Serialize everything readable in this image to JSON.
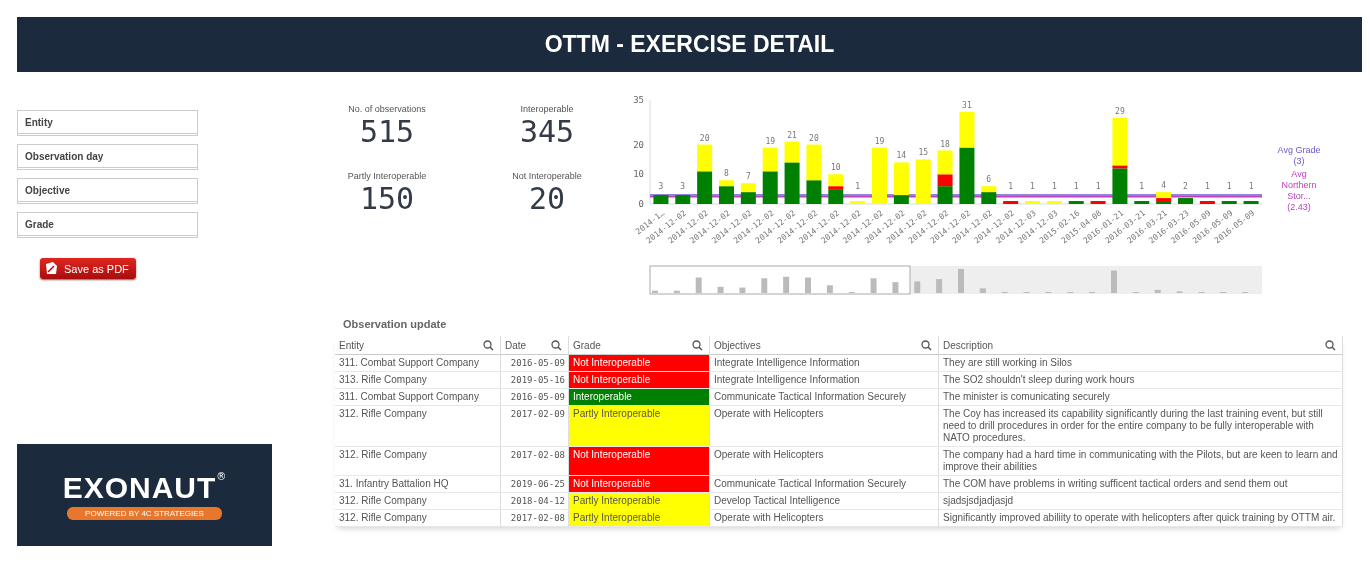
{
  "header": {
    "title": "OTTM - EXERCISE DETAIL"
  },
  "filters": [
    {
      "label": "Entity"
    },
    {
      "label": "Observation day"
    },
    {
      "label": "Objective"
    },
    {
      "label": "Grade"
    }
  ],
  "save_button": {
    "label": "Save as PDF"
  },
  "logo": {
    "name": "EXONAUT",
    "mark": "®",
    "tagline": "POWERED BY 4C STRATEGIES"
  },
  "kpis": [
    {
      "label": "No. of observations",
      "value": "515"
    },
    {
      "label": "Interoperable",
      "value": "345"
    },
    {
      "label": "Partly Interoperable",
      "value": "150"
    },
    {
      "label": "Not Interoperable",
      "value": "20"
    }
  ],
  "chart": {
    "chart_data": {
      "type": "bar",
      "stacked": true,
      "ylim": [
        0,
        35
      ],
      "yticks": [
        0,
        10,
        20,
        35
      ],
      "categories": [
        "2014-1…",
        "2014-12-02",
        "2014-12-02",
        "2014-12-02",
        "2014-12-02",
        "2014-12-02",
        "2014-12-02",
        "2014-12-02",
        "2014-12-02",
        "2014-12-02",
        "2014-12-02",
        "2014-12-02",
        "2014-12-02",
        "2014-12-02",
        "2014-12-02",
        "2014-12-02",
        "2014-12-02",
        "2014-12-03",
        "2014-12-03",
        "2015-02-16",
        "2015-04-08",
        "2016-01-21",
        "2016-03-21",
        "2016-03-21",
        "2016-03-23",
        "2016-05-09",
        "2016-05-09",
        "2016-05-09"
      ],
      "series": [
        {
          "color": "#008000",
          "values": [
            3,
            3,
            11,
            6,
            4,
            11,
            14,
            8,
            5,
            0,
            0,
            3,
            0,
            6,
            19,
            4,
            0,
            0,
            0,
            1,
            0,
            12,
            1,
            1,
            2,
            0,
            1,
            1
          ]
        },
        {
          "color": "#ff0000",
          "values": [
            0,
            0,
            0,
            0,
            0,
            0,
            0,
            0,
            1,
            0,
            0,
            0,
            0,
            4,
            0,
            0,
            1,
            0,
            0,
            0,
            1,
            1,
            0,
            1,
            0,
            1,
            0,
            0
          ]
        },
        {
          "color": "#ffff00",
          "values": [
            0,
            0,
            9,
            2,
            3,
            8,
            7,
            12,
            4,
            1,
            19,
            11,
            15,
            8,
            12,
            2,
            0,
            1,
            1,
            0,
            0,
            16,
            0,
            2,
            0,
            0,
            0,
            0
          ]
        }
      ],
      "value_labels": [
        [
          "3",
          "3",
          null,
          null,
          null,
          null,
          null,
          null,
          null,
          null,
          null,
          null,
          null,
          null,
          null,
          null,
          null,
          null,
          null,
          "1",
          null,
          null,
          "1",
          null,
          "2",
          null,
          "1",
          "1"
        ],
        [
          null,
          null,
          null,
          null,
          null,
          null,
          null,
          null,
          null,
          null,
          null,
          null,
          null,
          null,
          null,
          null,
          "1",
          null,
          null,
          null,
          "1",
          null,
          null,
          null,
          null,
          "1",
          null,
          null
        ],
        [
          null,
          null,
          "20",
          "8",
          "7",
          "19",
          "21",
          "20",
          "10",
          "1",
          "19",
          "14",
          "15",
          "18",
          "31",
          "6",
          null,
          "1",
          "1",
          null,
          null,
          "29",
          null,
          "4",
          null,
          null,
          null,
          null
        ]
      ],
      "ref_lines": [
        {
          "axis": "y",
          "value": 3,
          "label": "Avg Grade (3)",
          "color": "#6a5acd"
        },
        {
          "axis": "y",
          "value": 2.43,
          "label": "Avg Northern Stor... (2.43)",
          "color": "#c040c0"
        }
      ]
    }
  },
  "table": {
    "title": "Observation update",
    "columns": [
      {
        "label": "Entity"
      },
      {
        "label": "Date"
      },
      {
        "label": "Grade"
      },
      {
        "label": "Objectives"
      },
      {
        "label": "Description"
      }
    ],
    "rows": [
      {
        "entity": "311. Combat Support Company",
        "date": "2016-05-09",
        "grade": "Not Interoperable",
        "color": "#ff0000",
        "objective": "Integrate Intelligence Information",
        "description": "They are still working in Silos"
      },
      {
        "entity": "313. Rifle Company",
        "date": "2019-05-16",
        "grade": "Not Interoperable",
        "color": "#ff0000",
        "objective": "Integrate Intelligence Information",
        "description": "The SO2 shouldn't sleep during work hours"
      },
      {
        "entity": "311. Combat Support Company",
        "date": "2016-05-09",
        "grade": "Interoperable",
        "color": "#008000",
        "objective": "Communicate Tactical Information Securely",
        "description": "The minister is comunicating securely"
      },
      {
        "entity": "312. Rifle Company",
        "date": "2017-02-09",
        "grade": "Partly Interoperable",
        "color": "#ffff00",
        "objective": "Operate with Helicopters",
        "description": "The Coy has increased its capability significantly during the last training event, but still need to drill procedures in order for the entire company to be fully interoperable with NATO procedures."
      },
      {
        "entity": "312. Rifle Company",
        "date": "2017-02-08",
        "grade": "Not Interoperable",
        "color": "#ff0000",
        "objective": "Operate with Helicopters",
        "description": "The company had a hard time in communicating with the Pilots, but are keen to learn and improve their abilities"
      },
      {
        "entity": "31. Infantry Battalion HQ",
        "date": "2019-06-25",
        "grade": "Not Interoperable",
        "color": "#ff0000",
        "objective": "Communicate Tactical Information Securely",
        "description": "The COM have problems in writing sufficent tactical orders and send them out"
      },
      {
        "entity": "312. Rifle Company",
        "date": "2018-04-12",
        "grade": "Partly Interoperable",
        "color": "#ffff00",
        "objective": "Develop Tactical Intelligence",
        "description": "sjadsjsdjadjasjd"
      },
      {
        "entity": "312. Rifle Company",
        "date": "2017-02-08",
        "grade": "Partly Interoperable",
        "color": "#ffff00",
        "objective": "Operate with Helicopters",
        "description": "Significantly improved abiliity to operate with helicopters after quick training by OTTM air."
      }
    ]
  }
}
